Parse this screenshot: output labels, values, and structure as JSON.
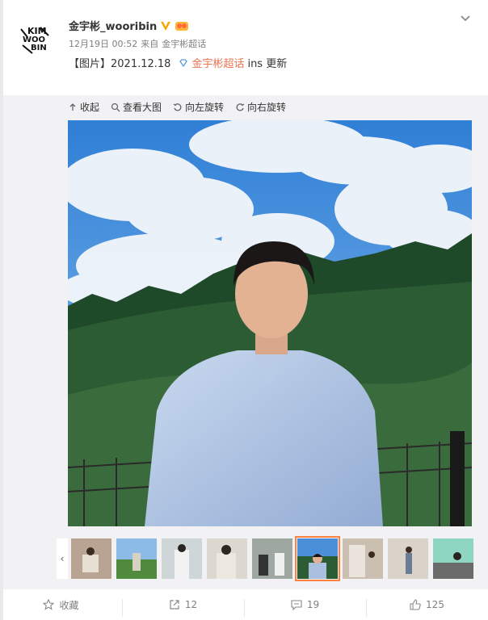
{
  "post": {
    "username": "金宇彬_wooribin",
    "time": "12月19日 00:52",
    "from": "来自",
    "source": "金宇彬超话",
    "text_prefix": "【图片】2021.12.18",
    "supertopic_link": "金宇彬超话",
    "text_suffix": "ins 更新",
    "avatar_text": "KIM WOO BIN"
  },
  "toolbar": {
    "collapse": "收起",
    "view_large": "查看大图",
    "rotate_left": "向左旋转",
    "rotate_right": "向右旋转"
  },
  "thumbnails": {
    "count": 9,
    "active_index": 5
  },
  "footer": {
    "favorite": "收藏",
    "repost_count": "12",
    "comment_count": "19",
    "like_count": "125"
  },
  "colors": {
    "accent": "#eb7350",
    "active_thumb": "#ff8140",
    "panel_bg": "#f2f2f5"
  }
}
